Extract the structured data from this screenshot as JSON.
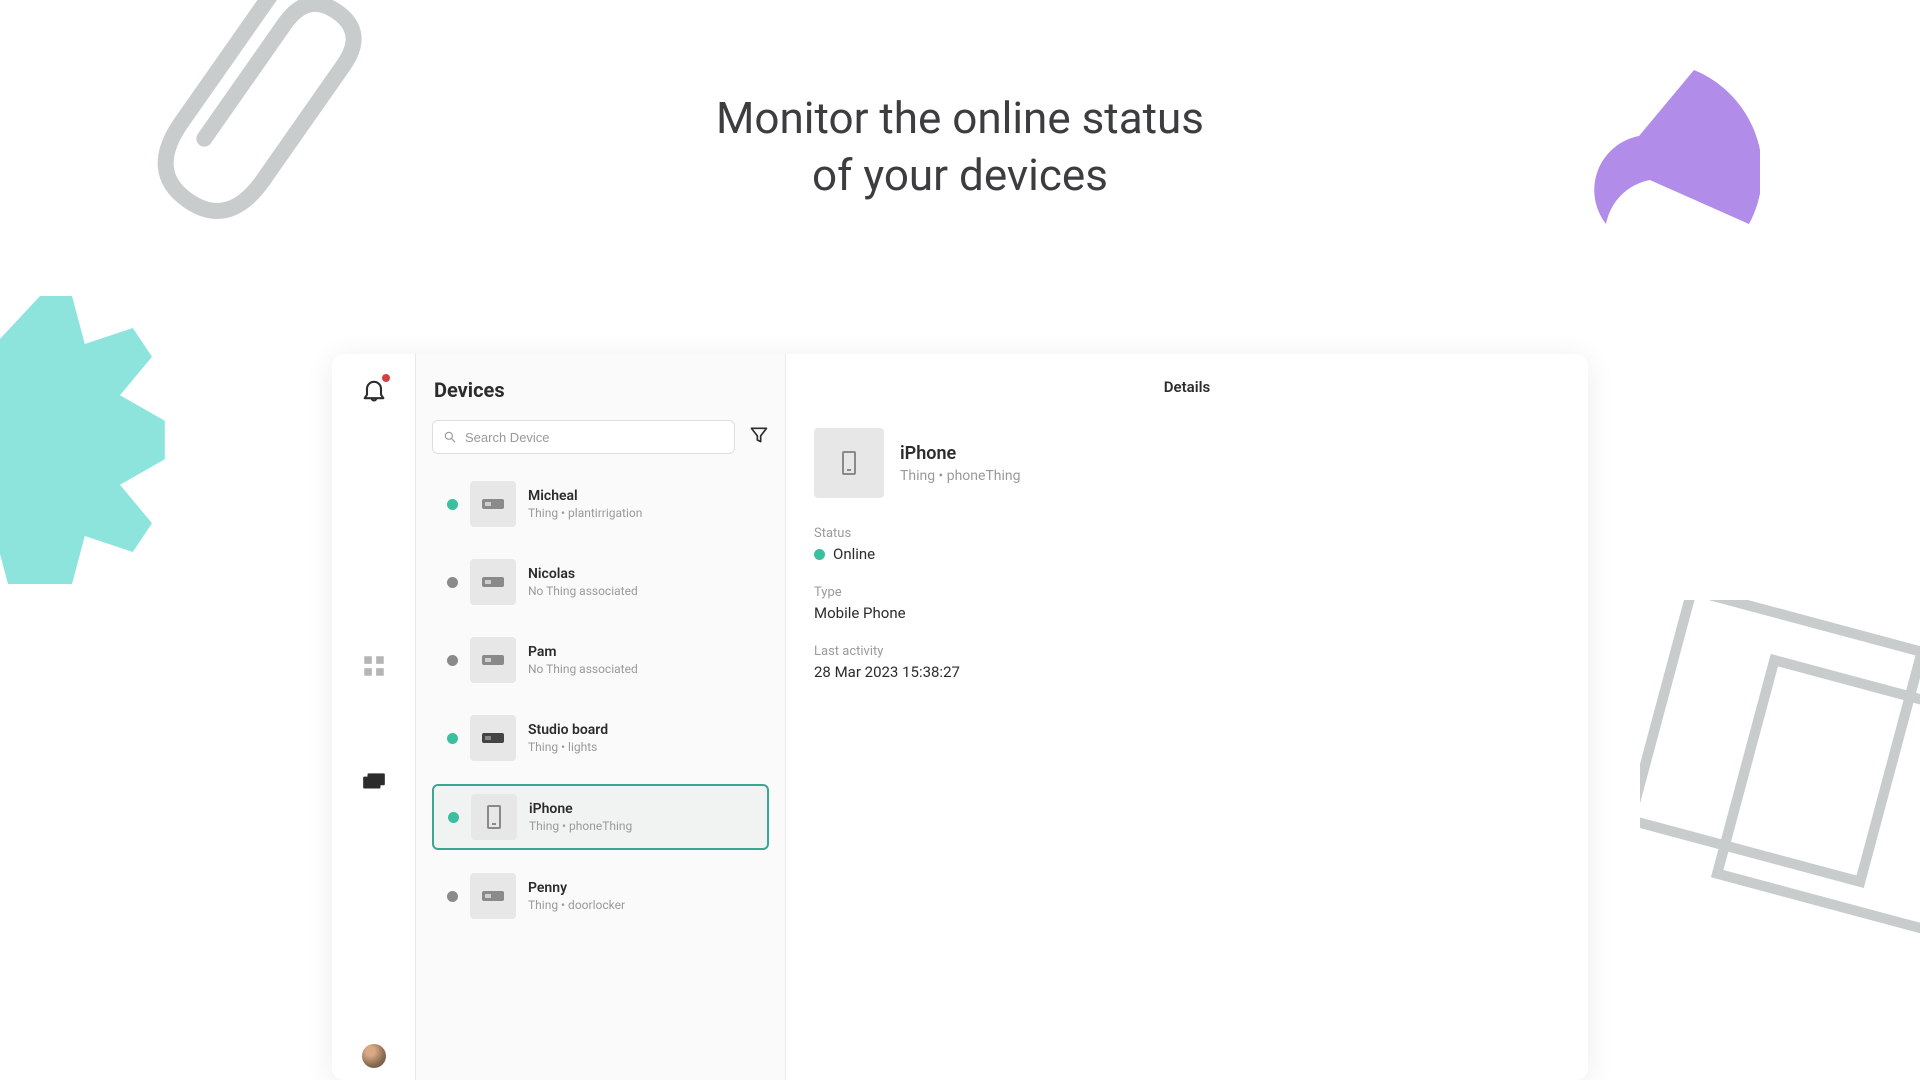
{
  "headline_line1": "Monitor the online status",
  "headline_line2": "of your devices",
  "colors": {
    "teal": "#8de4dc",
    "purple": "#b18ce8",
    "accent": "#3aa890",
    "status_online": "#3bbf9e",
    "status_offline": "#8a8a8a"
  },
  "devices_panel": {
    "title": "Devices",
    "search_placeholder": "Search Device",
    "items": [
      {
        "name": "Micheal",
        "sub": "Thing • plantirrigation",
        "status": "online",
        "icon": "chip",
        "selected": false
      },
      {
        "name": "Nicolas",
        "sub": "No Thing associated",
        "status": "offline",
        "icon": "chip",
        "selected": false
      },
      {
        "name": "Pam",
        "sub": "No Thing associated",
        "status": "offline",
        "icon": "chip",
        "selected": false
      },
      {
        "name": "Studio board",
        "sub": "Thing • lights",
        "status": "online",
        "icon": "chip-dark",
        "selected": false
      },
      {
        "name": "iPhone",
        "sub": "Thing • phoneThing",
        "status": "online",
        "icon": "phone",
        "selected": true
      },
      {
        "name": "Penny",
        "sub": "Thing • doorlocker",
        "status": "offline",
        "icon": "chip",
        "selected": false
      }
    ]
  },
  "details": {
    "tab_label": "Details",
    "title": "iPhone",
    "sub": "Thing • phoneThing",
    "status_label": "Status",
    "status_value": "Online",
    "status_state": "online",
    "type_label": "Type",
    "type_value": "Mobile Phone",
    "last_activity_label": "Last activity",
    "last_activity_value": "28 Mar 2023 15:38:27"
  }
}
